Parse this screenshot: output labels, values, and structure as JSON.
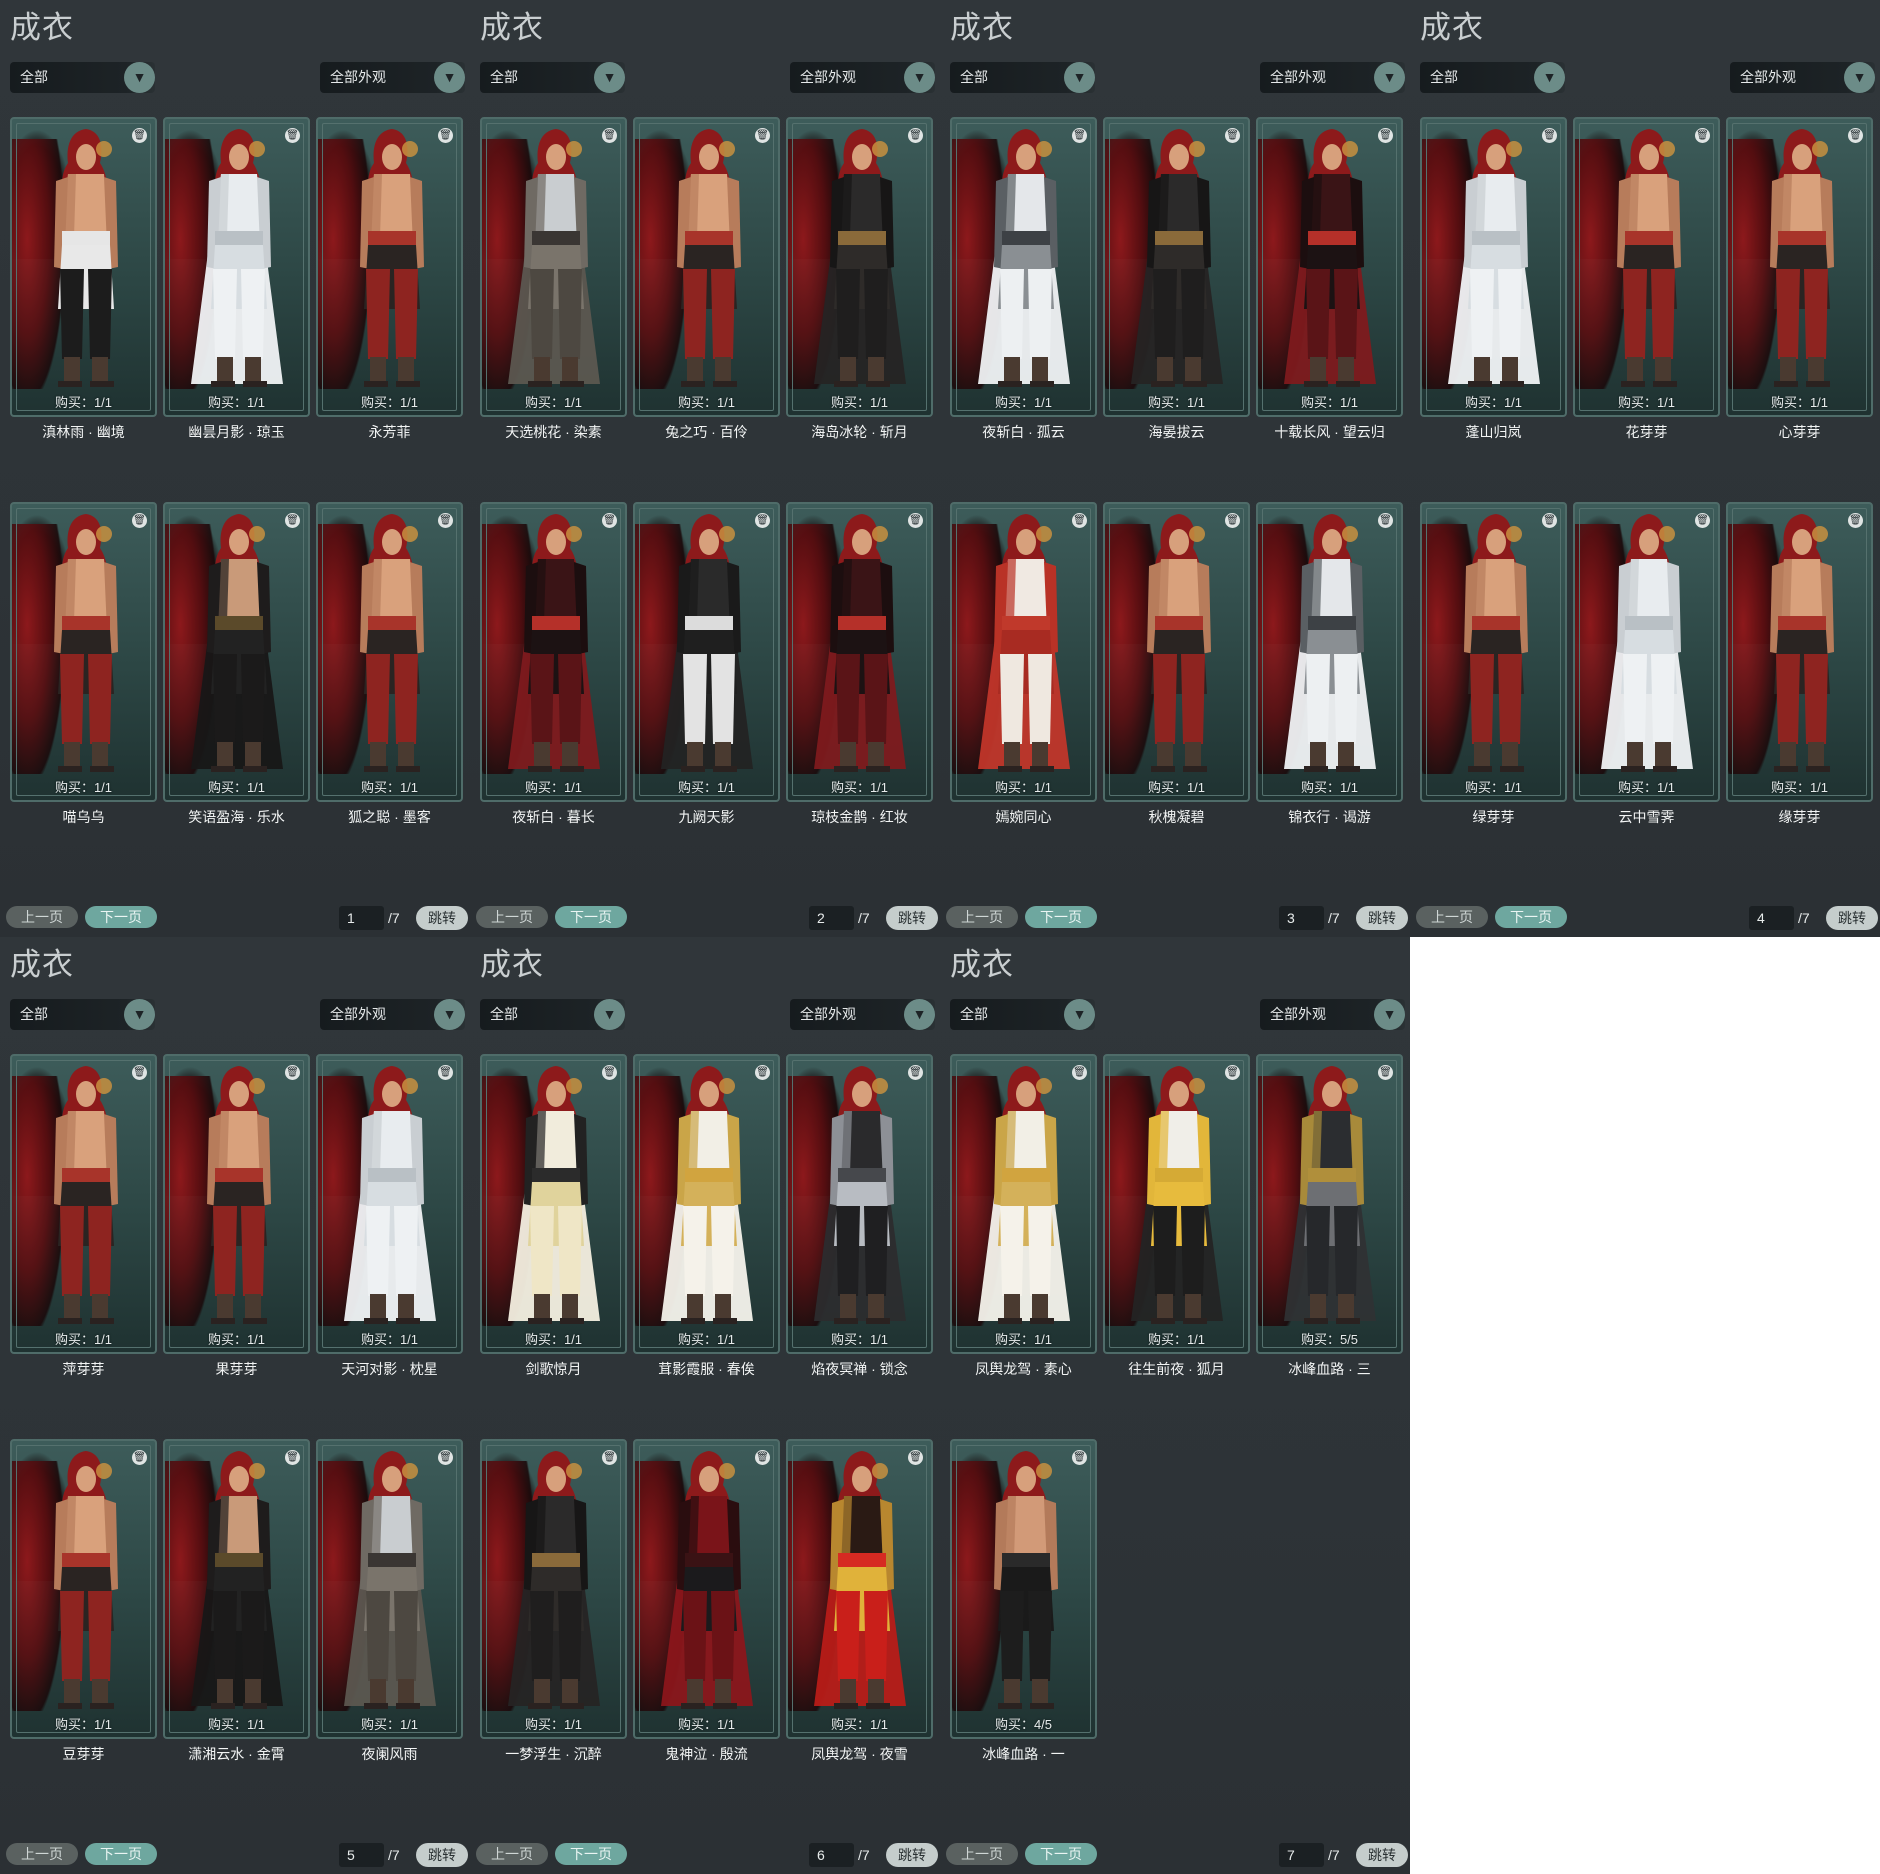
{
  "panels": [
    {
      "title": "成衣",
      "filter_left": "全部",
      "filter_right": "全部外观",
      "prev_label": "上一页",
      "next_label": "下一页",
      "page_input": "1",
      "page_total": "/7",
      "jump_label": "跳转",
      "items": [
        {
          "purchase": "购买：1/1",
          "name": "滇林雨 · 幽境",
          "outfit": "shirtless-white-sash"
        },
        {
          "purchase": "购买：1/1",
          "name": "幽昙月影 · 琼玉",
          "outfit": "white-robe"
        },
        {
          "purchase": "购买：1/1",
          "name": "永芳菲",
          "outfit": "default"
        },
        {
          "purchase": "购买：1/1",
          "name": "喵乌乌",
          "outfit": "default"
        },
        {
          "purchase": "购买：1/1",
          "name": "笑语盈海 · 乐水",
          "outfit": "black-open"
        },
        {
          "purchase": "购买：1/1",
          "name": "狐之聪 · 墨客",
          "outfit": "default"
        }
      ]
    },
    {
      "title": "成衣",
      "filter_left": "全部",
      "filter_right": "全部外观",
      "prev_label": "上一页",
      "next_label": "下一页",
      "page_input": "2",
      "page_total": "/7",
      "jump_label": "跳转",
      "items": [
        {
          "purchase": "购买：1/1",
          "name": "天选桃花 · 染素",
          "outfit": "grey-robe"
        },
        {
          "purchase": "购买：1/1",
          "name": "兔之巧 · 百伶",
          "outfit": "default"
        },
        {
          "purchase": "购买：1/1",
          "name": "海岛冰轮 · 斩月",
          "outfit": "black-robe"
        },
        {
          "purchase": "购买：1/1",
          "name": "夜斩白 · 暮长",
          "outfit": "red-black"
        },
        {
          "purchase": "购买：1/1",
          "name": "九阙天影",
          "outfit": "black-white"
        },
        {
          "purchase": "购买：1/1",
          "name": "琼枝金鹊 · 红妆",
          "outfit": "red-black"
        }
      ]
    },
    {
      "title": "成衣",
      "filter_left": "全部",
      "filter_right": "全部外观",
      "prev_label": "上一页",
      "next_label": "下一页",
      "page_input": "3",
      "page_total": "/7",
      "jump_label": "跳转",
      "items": [
        {
          "purchase": "购买：1/1",
          "name": "夜斩白 · 孤云",
          "outfit": "white-armor"
        },
        {
          "purchase": "购买：1/1",
          "name": "海晏拔云",
          "outfit": "black-robe"
        },
        {
          "purchase": "购买：1/1",
          "name": "十载长风 · 望云归",
          "outfit": "red-black"
        },
        {
          "purchase": "购买：1/1",
          "name": "嫣婉同心",
          "outfit": "red-white"
        },
        {
          "purchase": "购买：1/1",
          "name": "秋槐凝碧",
          "outfit": "default"
        },
        {
          "purchase": "购买：1/1",
          "name": "锦衣行 · 谒游",
          "outfit": "white-armor"
        }
      ]
    },
    {
      "title": "成衣",
      "filter_left": "全部",
      "filter_right": "全部外观",
      "prev_label": "上一页",
      "next_label": "下一页",
      "page_input": "4",
      "page_total": "/7",
      "jump_label": "跳转",
      "items": [
        {
          "purchase": "购买：1/1",
          "name": "蓬山归岚",
          "outfit": "white-robe"
        },
        {
          "purchase": "购买：1/1",
          "name": "花芽芽",
          "outfit": "default"
        },
        {
          "purchase": "购买：1/1",
          "name": "心芽芽",
          "outfit": "default"
        },
        {
          "purchase": "购买：1/1",
          "name": "绿芽芽",
          "outfit": "default"
        },
        {
          "purchase": "购买：1/1",
          "name": "云中雪霁",
          "outfit": "white-robe"
        },
        {
          "purchase": "购买：1/1",
          "name": "缘芽芽",
          "outfit": "default"
        }
      ]
    },
    {
      "title": "成衣",
      "filter_left": "全部",
      "filter_right": "全部外观",
      "prev_label": "上一页",
      "next_label": "下一页",
      "page_input": "5",
      "page_total": "/7",
      "jump_label": "跳转",
      "items": [
        {
          "purchase": "购买：1/1",
          "name": "萍芽芽",
          "outfit": "default"
        },
        {
          "purchase": "购买：1/1",
          "name": "果芽芽",
          "outfit": "default"
        },
        {
          "purchase": "购买：1/1",
          "name": "天河对影 · 枕星",
          "outfit": "white-robe"
        },
        {
          "purchase": "购买：1/1",
          "name": "豆芽芽",
          "outfit": "default"
        },
        {
          "purchase": "购买：1/1",
          "name": "潇湘云水 · 金霄",
          "outfit": "black-open"
        },
        {
          "purchase": "购买：1/1",
          "name": "夜阑风雨",
          "outfit": "grey-robe"
        }
      ]
    },
    {
      "title": "成衣",
      "filter_left": "全部",
      "filter_right": "全部外观",
      "prev_label": "上一页",
      "next_label": "下一页",
      "page_input": "6",
      "page_total": "/7",
      "jump_label": "跳转",
      "items": [
        {
          "purchase": "购买：1/1",
          "name": "剑歌惊月",
          "outfit": "cream-robe"
        },
        {
          "purchase": "购买：1/1",
          "name": "茸影霞服 · 春俟",
          "outfit": "white-gold"
        },
        {
          "purchase": "购买：1/1",
          "name": "焰夜冥禅 · 锁念",
          "outfit": "black-armor"
        },
        {
          "purchase": "购买：1/1",
          "name": "一梦浮生 · 沉醉",
          "outfit": "black-robe"
        },
        {
          "purchase": "购买：1/1",
          "name": "鬼神泣 · 殷流",
          "outfit": "crimson-armor"
        },
        {
          "purchase": "购买：1/1",
          "name": "凤舆龙驾 · 夜雪",
          "outfit": "red-gold"
        }
      ]
    },
    {
      "title": "成衣",
      "filter_left": "全部",
      "filter_right": "全部外观",
      "prev_label": "上一页",
      "next_label": "下一页",
      "page_input": "7",
      "page_total": "/7",
      "jump_label": "跳转",
      "items": [
        {
          "purchase": "购买：1/1",
          "name": "凤舆龙驾 · 素心",
          "outfit": "white-gold"
        },
        {
          "purchase": "购买：1/1",
          "name": "往生前夜 · 狐月",
          "outfit": "black-gold"
        },
        {
          "purchase": "购买：5/5",
          "name": "冰峰血路 · 三",
          "outfit": "dark-armor"
        },
        {
          "purchase": "购买：4/5",
          "name": "冰峰血路 · 一",
          "outfit": "shirtless-dark"
        }
      ]
    }
  ],
  "icons": {
    "dropdown": "chevron-down-icon",
    "delete": "trash-icon"
  },
  "colors": {
    "panel_bg": "#2f3539",
    "card_teal": "#2c4644",
    "next_btn": "#6ea79f",
    "accent_red": "#9a1a1d"
  }
}
